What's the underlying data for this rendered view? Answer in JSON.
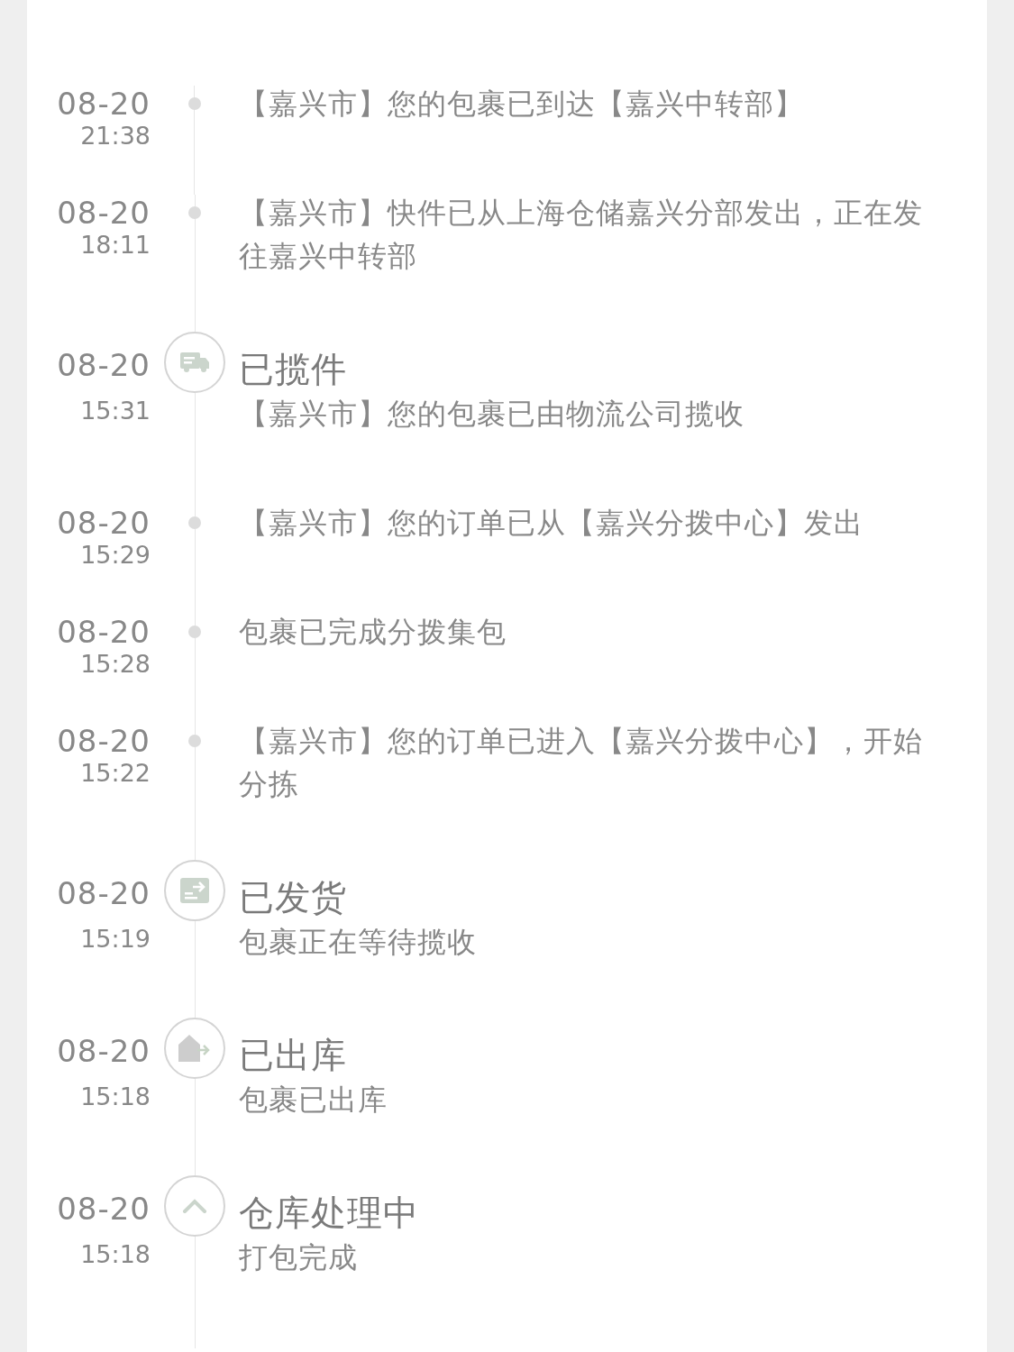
{
  "events": [
    {
      "kind": "dot",
      "date": "08-20",
      "time": "21:38",
      "text": "【嘉兴市】您的包裹已到达【嘉兴中转部】"
    },
    {
      "kind": "dot",
      "date": "08-20",
      "time": "18:11",
      "text": "【嘉兴市】快件已从上海仓储嘉兴分部发出，正在发往嘉兴中转部"
    },
    {
      "kind": "milestone",
      "date": "08-20",
      "time": "15:31",
      "title": "已揽件",
      "text": "【嘉兴市】您的包裹已由物流公司揽收"
    },
    {
      "kind": "dot",
      "date": "08-20",
      "time": "15:29",
      "text": "【嘉兴市】您的订单已从【嘉兴分拨中心】发出"
    },
    {
      "kind": "dot",
      "date": "08-20",
      "time": "15:28",
      "text": "包裹已完成分拨集包"
    },
    {
      "kind": "dot",
      "date": "08-20",
      "time": "15:22",
      "text": "【嘉兴市】您的订单已进入【嘉兴分拨中心】，开始分拣"
    },
    {
      "kind": "milestone",
      "date": "08-20",
      "time": "15:19",
      "title": "已发货",
      "text": "包裹正在等待揽收"
    },
    {
      "kind": "milestone",
      "date": "08-20",
      "time": "15:18",
      "title": "已出库",
      "text": "包裹已出库"
    },
    {
      "kind": "milestone",
      "date": "08-20",
      "time": "15:18",
      "title": "仓库处理中",
      "text": "打包完成"
    }
  ]
}
